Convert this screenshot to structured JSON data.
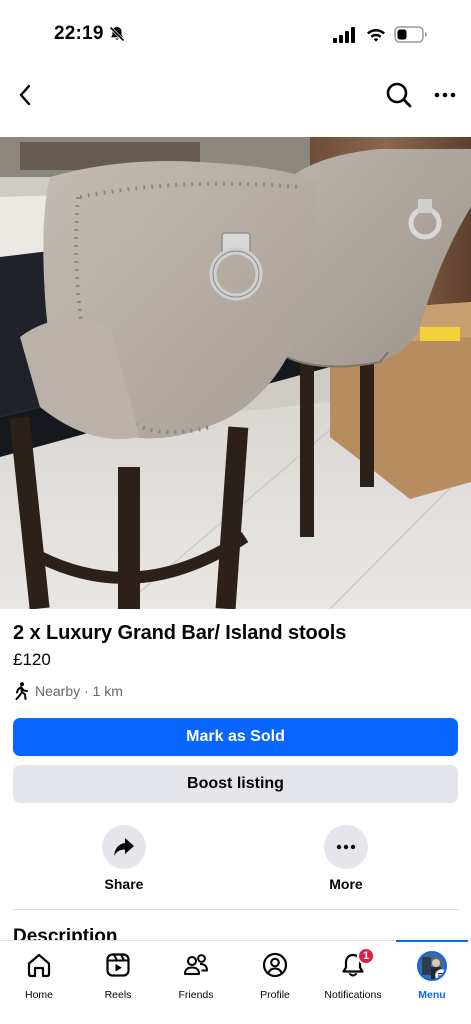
{
  "status_bar": {
    "time": "22:19"
  },
  "nav": {
    "back_icon": "chevron-left-icon",
    "search_icon": "search-icon",
    "more_icon": "ellipsis-icon"
  },
  "photo": {
    "subject": "bar-stools-photo",
    "total_images": 5,
    "active_index": 0
  },
  "listing": {
    "title": "2 x Luxury Grand Bar/ Island stools",
    "price": "£120",
    "location": "Nearby · 1 km"
  },
  "buttons": {
    "mark_sold": "Mark as Sold",
    "boost": "Boost listing"
  },
  "actions": [
    {
      "label": "Share",
      "icon": "share-arrow-icon"
    },
    {
      "label": "More",
      "icon": "ellipsis-icon"
    }
  ],
  "section": {
    "heading": "Description"
  },
  "tabs": [
    {
      "label": "Home",
      "icon": "home-icon"
    },
    {
      "label": "Reels",
      "icon": "reels-icon"
    },
    {
      "label": "Friends",
      "icon": "friends-icon"
    },
    {
      "label": "Profile",
      "icon": "profile-icon"
    },
    {
      "label": "Notifications",
      "icon": "bell-icon",
      "badge": "1"
    },
    {
      "label": "Menu",
      "icon": "avatar-menu-icon",
      "active": true
    }
  ],
  "colors": {
    "primary": "#0866ff",
    "secondary_bg": "#e4e6eb",
    "badge": "#e41e3f",
    "muted_text": "#65676b"
  }
}
